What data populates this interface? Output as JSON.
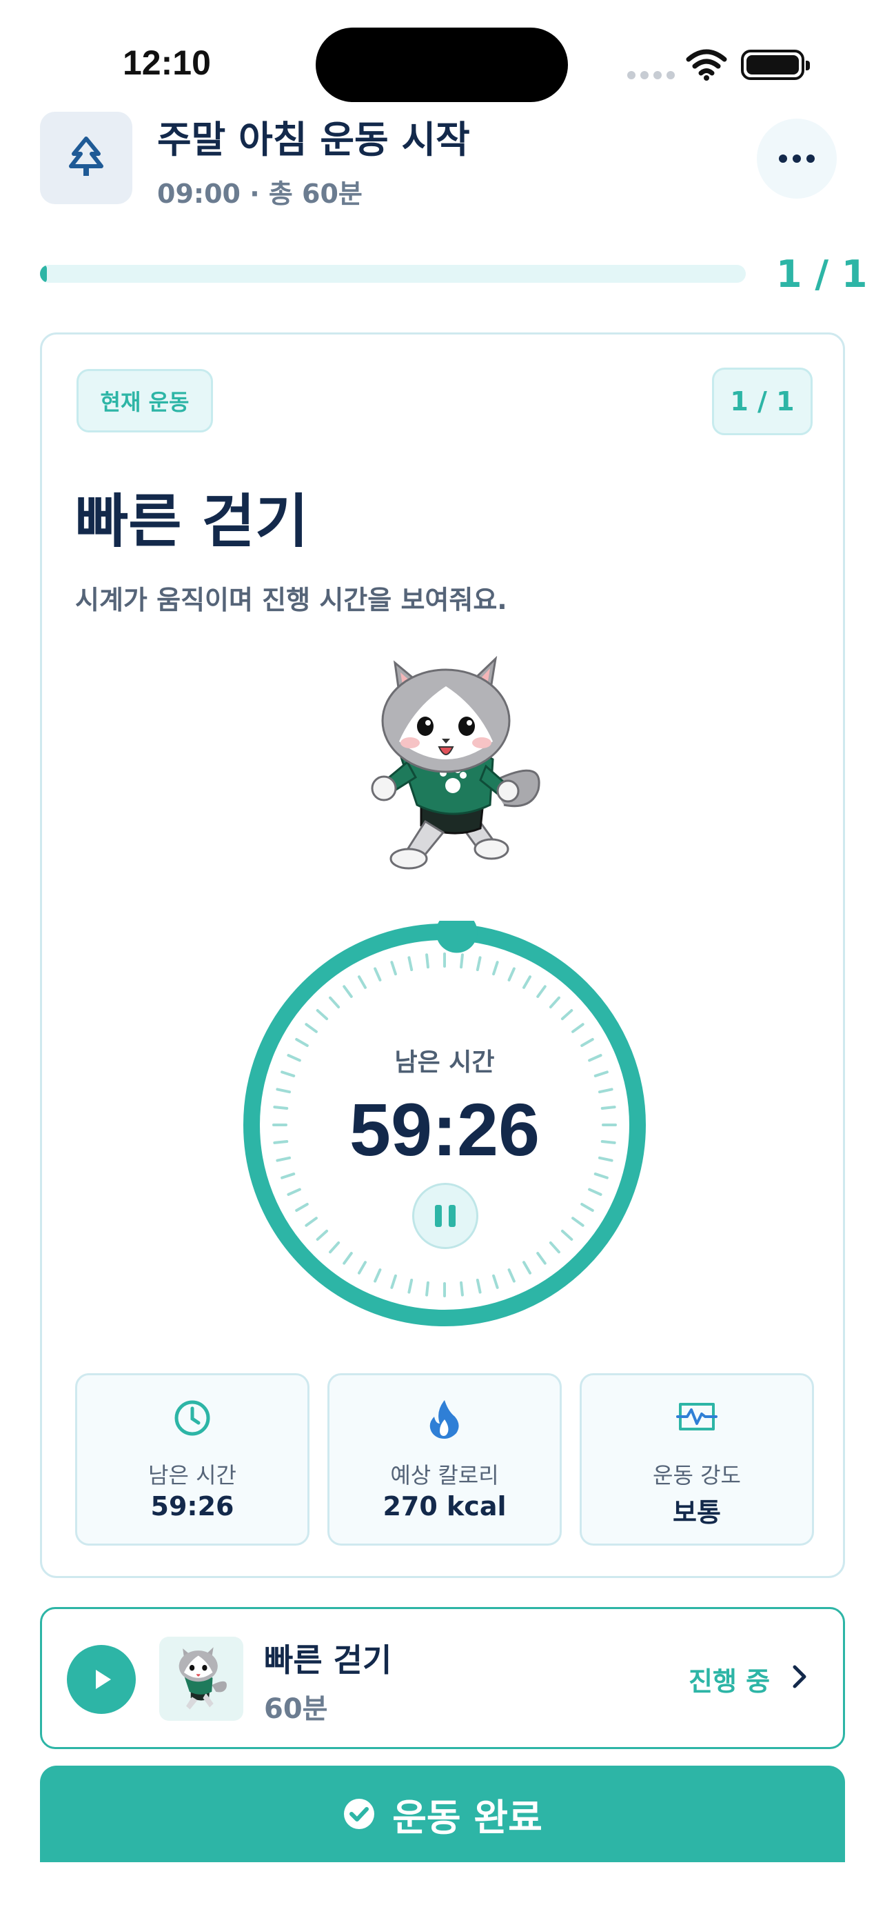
{
  "status_bar": {
    "time": "12:10"
  },
  "header": {
    "title": "주말 아침 운동 시작",
    "subtitle": "09:00 · 총 60분",
    "icon": "tree-icon",
    "more_icon": "more-dots-icon"
  },
  "progress": {
    "label": "1 / 1",
    "fraction": 0.01
  },
  "current": {
    "badge": "현재 운동",
    "count": "1 / 1",
    "title": "빠른 걷기",
    "description": "시계가 움직이며 진행 시간을 보여줘요.",
    "mascot": "running-cat-mascot",
    "timer": {
      "label": "남은 시간",
      "value": "59:26",
      "fraction_remaining": 0.99
    },
    "stats": [
      {
        "icon": "clock-icon",
        "label": "남은 시간",
        "value": "59:26"
      },
      {
        "icon": "flame-icon",
        "label": "예상 칼로리",
        "value": "270 kcal"
      },
      {
        "icon": "pulse-icon",
        "label": "운동 강도",
        "value": "보통"
      }
    ]
  },
  "playlist_row": {
    "title": "빠른 걷기",
    "duration": "60분",
    "status": "진행 중"
  },
  "complete_button": {
    "label": "운동 완료"
  },
  "colors": {
    "accent": "#2db5a6",
    "navy": "#13294b",
    "muted": "#6b7c90",
    "soft_bg": "#e6f7f8",
    "border": "#cfe9ef"
  }
}
